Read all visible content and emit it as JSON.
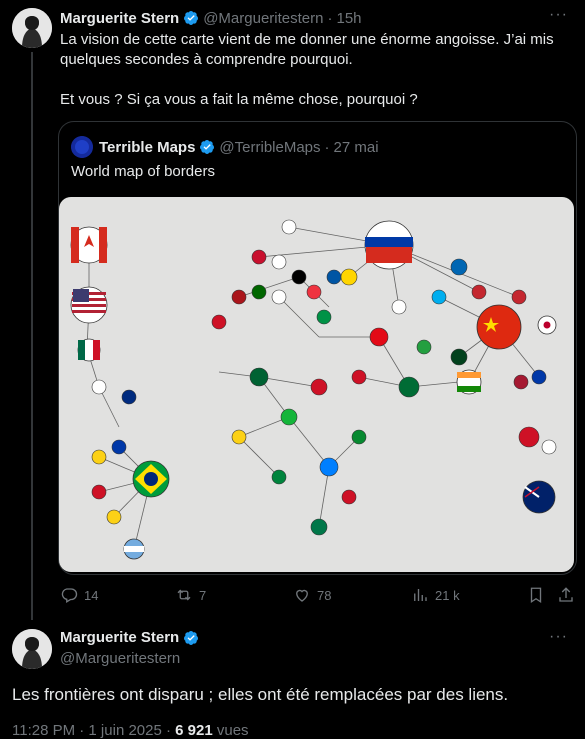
{
  "tweet1": {
    "author_name": "Marguerite Stern",
    "handle": "@Margueritestern",
    "time": "15h",
    "text_line1": "La vision de cette carte vient de me donner une énorme angoisse. J’ai mis",
    "text_line2": "quelques secondes à comprendre pourquoi.",
    "text_line3": "Et vous ? Si ça vous a fait la même chose, pourquoi ?",
    "more": "···"
  },
  "quote": {
    "author_name": "Terrible Maps",
    "handle": "@TerribleMaps",
    "date": "27 mai",
    "text": "World map of borders"
  },
  "actions": {
    "replies": "14",
    "reposts": "7",
    "likes": "78",
    "views": "21 k"
  },
  "tweet2": {
    "author_name": "Marguerite Stern",
    "handle": "@Margueritestern",
    "text": "Les frontières ont disparu ; elles ont été remplacées par des liens.",
    "footer_time": "11:28 PM · 1 juin 2025 ·",
    "footer_views": "6 921",
    "footer_views_label": "vues",
    "more": "···"
  },
  "colors": {
    "verified": "#1d9bf0",
    "muted": "#71767b",
    "border": "#2f3336"
  },
  "icons": [
    "reply-icon",
    "repost-icon",
    "like-icon",
    "views-icon",
    "bookmark-icon",
    "share-icon",
    "verified-icon"
  ]
}
